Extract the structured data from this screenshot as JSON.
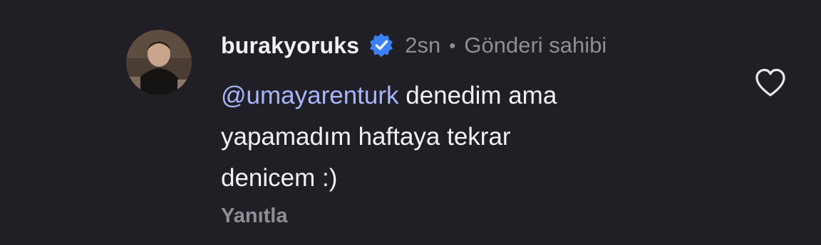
{
  "comment": {
    "username": "burakyoruks",
    "verified": true,
    "time": "2sn",
    "separator": "•",
    "owner_badge": "Gönderi sahibi",
    "mention": "@umayarenturk",
    "text_line1": " denedim ama",
    "text_line2": "yapamadım haftaya tekrar",
    "text_line3": "denicem :)",
    "reply_label": "Yanıtla"
  },
  "icons": {
    "verified": "verified-badge-icon",
    "like": "heart-outline-icon"
  },
  "colors": {
    "background": "#201f25",
    "mention": "#a8b6ff",
    "verified_badge": "#3b82f6",
    "muted_text": "#8e8e96"
  }
}
